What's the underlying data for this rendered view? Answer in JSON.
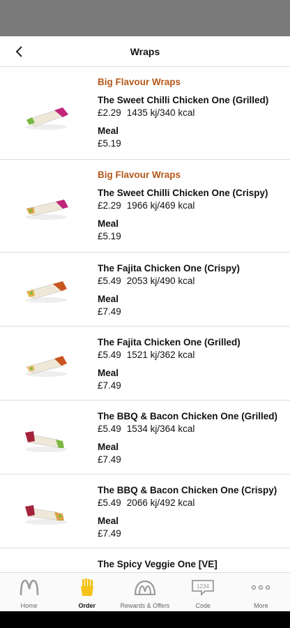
{
  "header": {
    "title": "Wraps"
  },
  "items": [
    {
      "tag": "Big Flavour Wraps",
      "name": "The Sweet Chilli Chicken One (Grilled)",
      "price": "£2.29",
      "energy": "1435 kj/340 kcal",
      "meal_label": "Meal",
      "meal_price": "£5.19"
    },
    {
      "tag": "Big Flavour Wraps",
      "name": "The Sweet Chilli Chicken One (Crispy)",
      "price": "£2.29",
      "energy": "1966 kj/469 kcal",
      "meal_label": "Meal",
      "meal_price": "£5.19"
    },
    {
      "tag": "",
      "name": "The Fajita Chicken One (Crispy)",
      "price": "£5.49",
      "energy": "2053 kj/490 kcal",
      "meal_label": "Meal",
      "meal_price": "£7.49"
    },
    {
      "tag": "",
      "name": "The Fajita Chicken One (Grilled)",
      "price": "£5.49",
      "energy": "1521 kj/362 kcal",
      "meal_label": "Meal",
      "meal_price": "£7.49"
    },
    {
      "tag": "",
      "name": "The BBQ & Bacon Chicken One (Grilled)",
      "price": "£5.49",
      "energy": "1534 kj/364 kcal",
      "meal_label": "Meal",
      "meal_price": "£7.49"
    },
    {
      "tag": "",
      "name": "The BBQ & Bacon Chicken One (Crispy)",
      "price": "£5.49",
      "energy": "2066 kj/492 kcal",
      "meal_label": "Meal",
      "meal_price": "£7.49"
    },
    {
      "tag": "",
      "name": "The Spicy Veggie One [VE]",
      "price": "",
      "energy": "",
      "meal_label": "",
      "meal_price": ""
    }
  ],
  "tabs": [
    {
      "label": "Home",
      "icon": "arches-icon",
      "active": false
    },
    {
      "label": "Order",
      "icon": "fries-icon",
      "active": true
    },
    {
      "label": "Rewards & Offers",
      "icon": "rewards-arches-icon",
      "active": false
    },
    {
      "label": "Code",
      "icon": "code-1234-icon",
      "active": false
    },
    {
      "label": "More",
      "icon": "more-dots-icon",
      "active": false
    }
  ],
  "code_icon_text": "1234",
  "colors": {
    "accent_tag": "#b4581a",
    "fries_yellow": "#f6c21a",
    "status_bar": "#7a7a7a"
  }
}
